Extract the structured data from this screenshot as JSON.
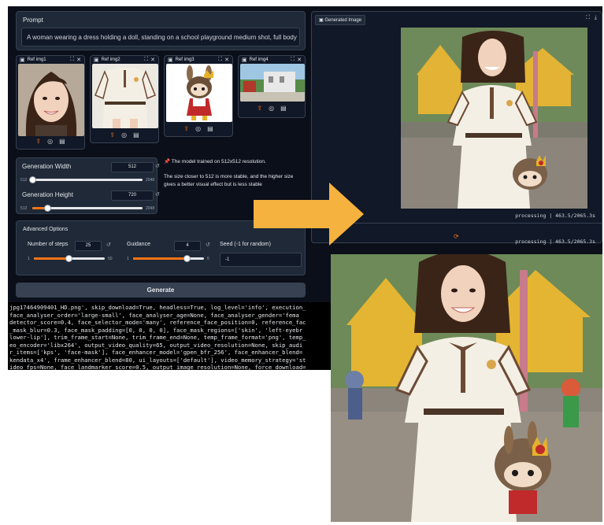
{
  "prompt": {
    "label": "Prompt",
    "value": "A woman wearing a dress holding a doll, standing on a school playground medium shot, full body"
  },
  "refs": [
    {
      "label": "Ref img1"
    },
    {
      "label": "Ref img2"
    },
    {
      "label": "Ref img3"
    },
    {
      "label": "Ref img4"
    }
  ],
  "generation_width": {
    "label": "Generation Width",
    "value": "512",
    "min": "512",
    "max": "2048",
    "level": 0.0
  },
  "generation_height": {
    "label": "Generation Height",
    "value": "720",
    "min": "512",
    "max": "2048",
    "level": 0.135
  },
  "info": {
    "line1": "📌 The model trained on 512x512 resolution.",
    "line2": "The size closer to 512 is more stable, and the higher size gives a better visual effect but is less stable"
  },
  "advanced": {
    "title": "Advanced Options",
    "steps": {
      "label": "Number of steps",
      "value": "25",
      "min": "1",
      "max": "50",
      "level": 0.49
    },
    "guidance": {
      "label": "Guidance",
      "value": "4",
      "min": "1",
      "max": "5",
      "level": 0.75
    },
    "seed": {
      "label": "Seed (-1 for random)",
      "value": "-1"
    }
  },
  "generate_label": "Generate",
  "output": {
    "tab_label": "Generated Image",
    "status": "processing | 463.5/2065.3s"
  },
  "log_lines": [
    "jpg17464909401_HD.png', skip_download=True, headless=True, log_level='info', execution_",
    " face_analyser_order='large-small', face_analyser_age=None, face_analyser_gender='fema",
    "detector_score=0.4, face_selector_mode='many', reference_face_position=0, reference_fac",
    "_mask_blur=0.3, face_mask_padding=[0, 0, 0, 0], face_mask_regions=['skin', 'left-eyebr",
    "lower-lip'], trim_frame_start=None, trim_frame_end=None, temp_frame_format='png', temp_",
    "eo_encoder='libx264', output_video_quality=65, output_video_resolution=None, skip_audi",
    "r_items=['kps', 'face-mask'], face_enhancer_model='gpen_bfr_256', face_enhancer_blend=",
    "kendata_x4', frame_enhancer_blend=80, ui_layouts=['default'], video_memory_strategy='st",
    "ideo_fps=None, face_landmarker_score=0.5, output_image_resolution=None, force_download="
  ],
  "colors": {
    "accent": "#f97316",
    "arrow": "#f6b23e",
    "bg": "#0b0f19"
  }
}
